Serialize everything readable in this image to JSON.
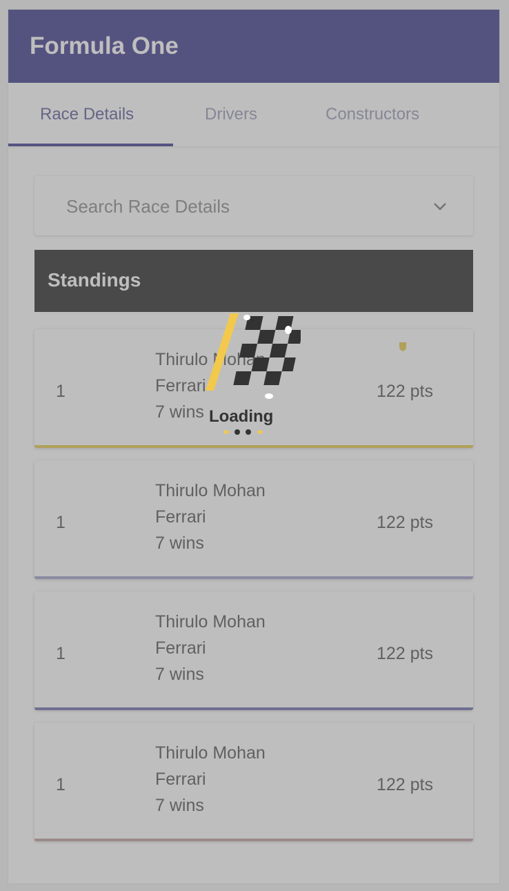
{
  "app": {
    "title": "Formula One"
  },
  "tabs": [
    {
      "label": "Race Details",
      "active": true
    },
    {
      "label": "Drivers",
      "active": false
    },
    {
      "label": "Constructors",
      "active": false
    }
  ],
  "search": {
    "placeholder": "Search Race Details",
    "icon": "chevron-down-icon"
  },
  "section": {
    "label": "Standings"
  },
  "standings": [
    {
      "position": "1",
      "driver": "Thirulo Mohan",
      "team": "Ferrari",
      "wins": "7 wins",
      "points": "122 pts",
      "accent": "#e8c94a"
    },
    {
      "position": "1",
      "driver": "Thirulo Mohan",
      "team": "Ferrari",
      "wins": "7 wins",
      "points": "122 pts",
      "accent": "#a0a0c8"
    },
    {
      "position": "1",
      "driver": "Thirulo Mohan",
      "team": "Ferrari",
      "wins": "7 wins",
      "points": "122 pts",
      "accent": "#7070b0"
    },
    {
      "position": "1",
      "driver": "Thirulo Mohan",
      "team": "Ferrari",
      "wins": "7 wins",
      "points": "122 pts",
      "accent": "#c0a0a0"
    }
  ],
  "loading": {
    "label": "Loading",
    "icon": "checkered-flag-icon"
  },
  "colors": {
    "primary": "#3f3c8e",
    "section": "#2b2b2b",
    "flag_pole": "#f2c94c"
  }
}
